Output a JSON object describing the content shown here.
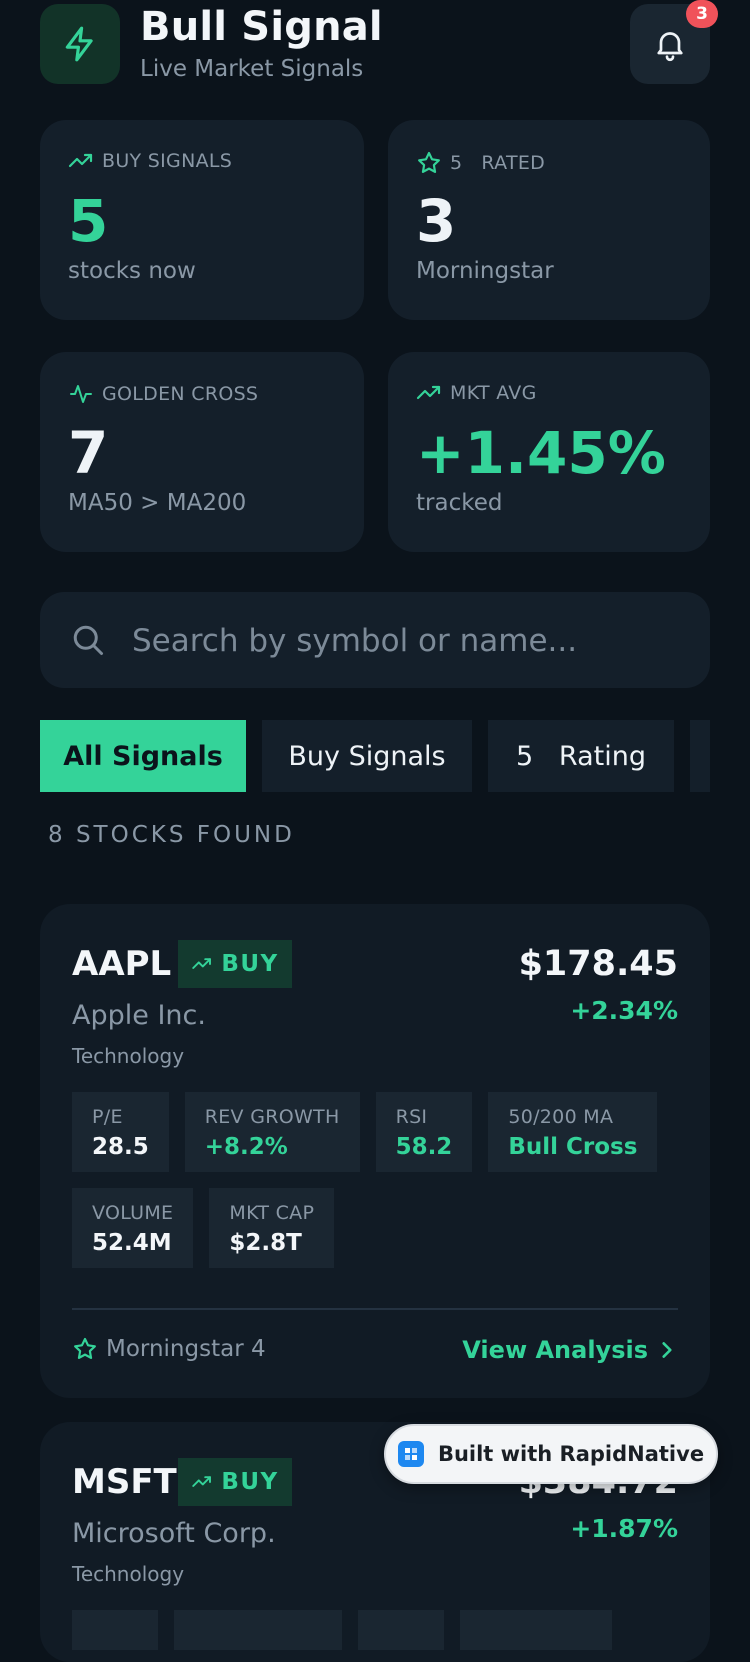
{
  "header": {
    "title": "Bull Signal",
    "subtitle": "Live Market Signals",
    "notification_count": "3"
  },
  "stats": [
    {
      "label": "BUY SIGNALS",
      "value": "5",
      "sub": "stocks now",
      "icon": "trending-up-icon",
      "accent": "#34d399"
    },
    {
      "label": "5   RATED",
      "value": "3",
      "sub": "Morningstar",
      "icon": "star-icon"
    },
    {
      "label": "GOLDEN CROSS",
      "value": "7",
      "sub": "MA50 > MA200",
      "icon": "activity-icon"
    },
    {
      "label": "MKT AVG",
      "value": "+1.45%",
      "sub": "tracked",
      "icon": "trending-up-icon",
      "accent": "#34d399"
    }
  ],
  "search": {
    "placeholder": "Search by symbol or name..."
  },
  "tabs": [
    {
      "label": "All Signals",
      "active": true
    },
    {
      "label": "Buy Signals",
      "active": false
    },
    {
      "label": "5   Rating",
      "active": false
    }
  ],
  "results_count": "8 STOCKS FOUND",
  "stocks": [
    {
      "symbol": "AAPL",
      "signal": "BUY",
      "name": "Apple Inc.",
      "sector": "Technology",
      "price": "$178.45",
      "change": "+2.34%",
      "metrics": [
        {
          "label": "P/E",
          "value": "28.5"
        },
        {
          "label": "REV GROWTH",
          "value": "+8.2%",
          "positive": true
        },
        {
          "label": "RSI",
          "value": "58.2",
          "positive": true
        },
        {
          "label": "50/200 MA",
          "value": "Bull Cross",
          "positive": true
        },
        {
          "label": "VOLUME",
          "value": "52.4M"
        },
        {
          "label": "MKT CAP",
          "value": "$2.8T"
        }
      ],
      "morningstar": "Morningstar 4",
      "action": "View Analysis"
    },
    {
      "symbol": "MSFT",
      "signal": "BUY",
      "name": "Microsoft Corp.",
      "sector": "Technology",
      "price": "$384.72",
      "change": "+1.87%"
    }
  ],
  "branding": {
    "label": "Built with RapidNative"
  },
  "colors": {
    "accent": "#34d399",
    "background": "#0b131b",
    "card": "#141f2a",
    "badge": "#f0525a"
  }
}
